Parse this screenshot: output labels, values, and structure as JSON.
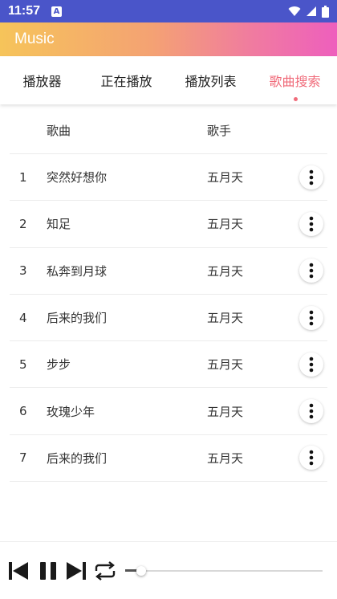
{
  "status_bar": {
    "time": "11:57",
    "notification_letter": "A"
  },
  "app_bar": {
    "title": "Music"
  },
  "tabs": [
    {
      "label": "播放器",
      "active": false
    },
    {
      "label": "正在播放",
      "active": false
    },
    {
      "label": "播放列表",
      "active": false
    },
    {
      "label": "歌曲搜索",
      "active": true
    }
  ],
  "table": {
    "headers": {
      "song": "歌曲",
      "artist": "歌手"
    },
    "rows": [
      {
        "num": "1",
        "song": "突然好想你",
        "artist": "五月天"
      },
      {
        "num": "2",
        "song": "知足",
        "artist": "五月天"
      },
      {
        "num": "3",
        "song": "私奔到月球",
        "artist": "五月天"
      },
      {
        "num": "4",
        "song": "后来的我们",
        "artist": "五月天"
      },
      {
        "num": "5",
        "song": "步步",
        "artist": "五月天"
      },
      {
        "num": "6",
        "song": "玫瑰少年",
        "artist": "五月天"
      },
      {
        "num": "7",
        "song": "后来的我们",
        "artist": "五月天"
      }
    ]
  },
  "player": {
    "progress": 0.08
  },
  "colors": {
    "accent": "#f06b7a",
    "status_bar": "#4a55c9"
  }
}
